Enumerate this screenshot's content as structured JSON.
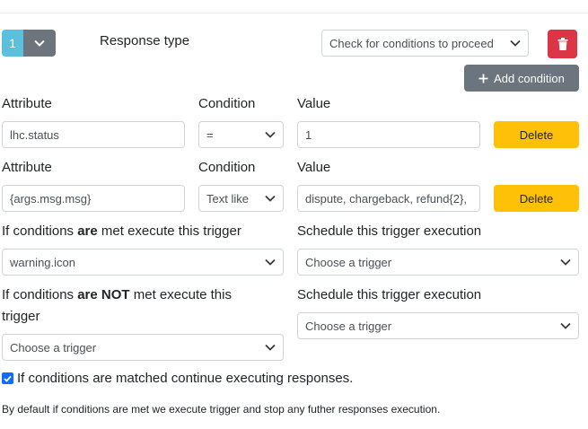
{
  "response": {
    "number": "1",
    "type_label": "Response type",
    "type_value": "Check for conditions to proceed"
  },
  "toolbar": {
    "add_condition_label": "Add condition",
    "add_icon": "plus-icon",
    "delete_icon": "trash-icon",
    "expand_icon": "chevron-down-icon"
  },
  "conditions": [
    {
      "attribute_label": "Attribute",
      "condition_label": "Condition",
      "value_label": "Value",
      "attribute": "lhc.status",
      "operator": "=",
      "value": "1",
      "delete_label": "Delete"
    },
    {
      "attribute_label": "Attribute",
      "condition_label": "Condition",
      "value_label": "Value",
      "attribute": "{args.msg.msg}",
      "operator": "Text like",
      "value": "dispute, chargeback, refund{2},",
      "delete_label": "Delete"
    }
  ],
  "met": {
    "label_pre": "If conditions ",
    "label_bold": "are",
    "label_post": " met execute this trigger",
    "trigger": "warning.icon",
    "schedule_label": "Schedule this trigger execution",
    "schedule_value": "Choose a trigger"
  },
  "not_met": {
    "label_pre": "If conditions ",
    "label_bold": "are NOT",
    "label_post": " met execute this",
    "label_line2": "trigger",
    "trigger": "Choose a trigger",
    "schedule_label": "Schedule this trigger execution",
    "schedule_value": "Choose a trigger"
  },
  "continue": {
    "checked": true,
    "label": "If conditions are matched continue executing responses."
  },
  "footnote": "By default if conditions are met we execute trigger and stop any futher responses execution.",
  "colors": {
    "info": "#5bc0de",
    "secondary": "#6c757d",
    "danger": "#dc3545",
    "warning": "#ffc107",
    "checkbox": "#0d6efd"
  }
}
